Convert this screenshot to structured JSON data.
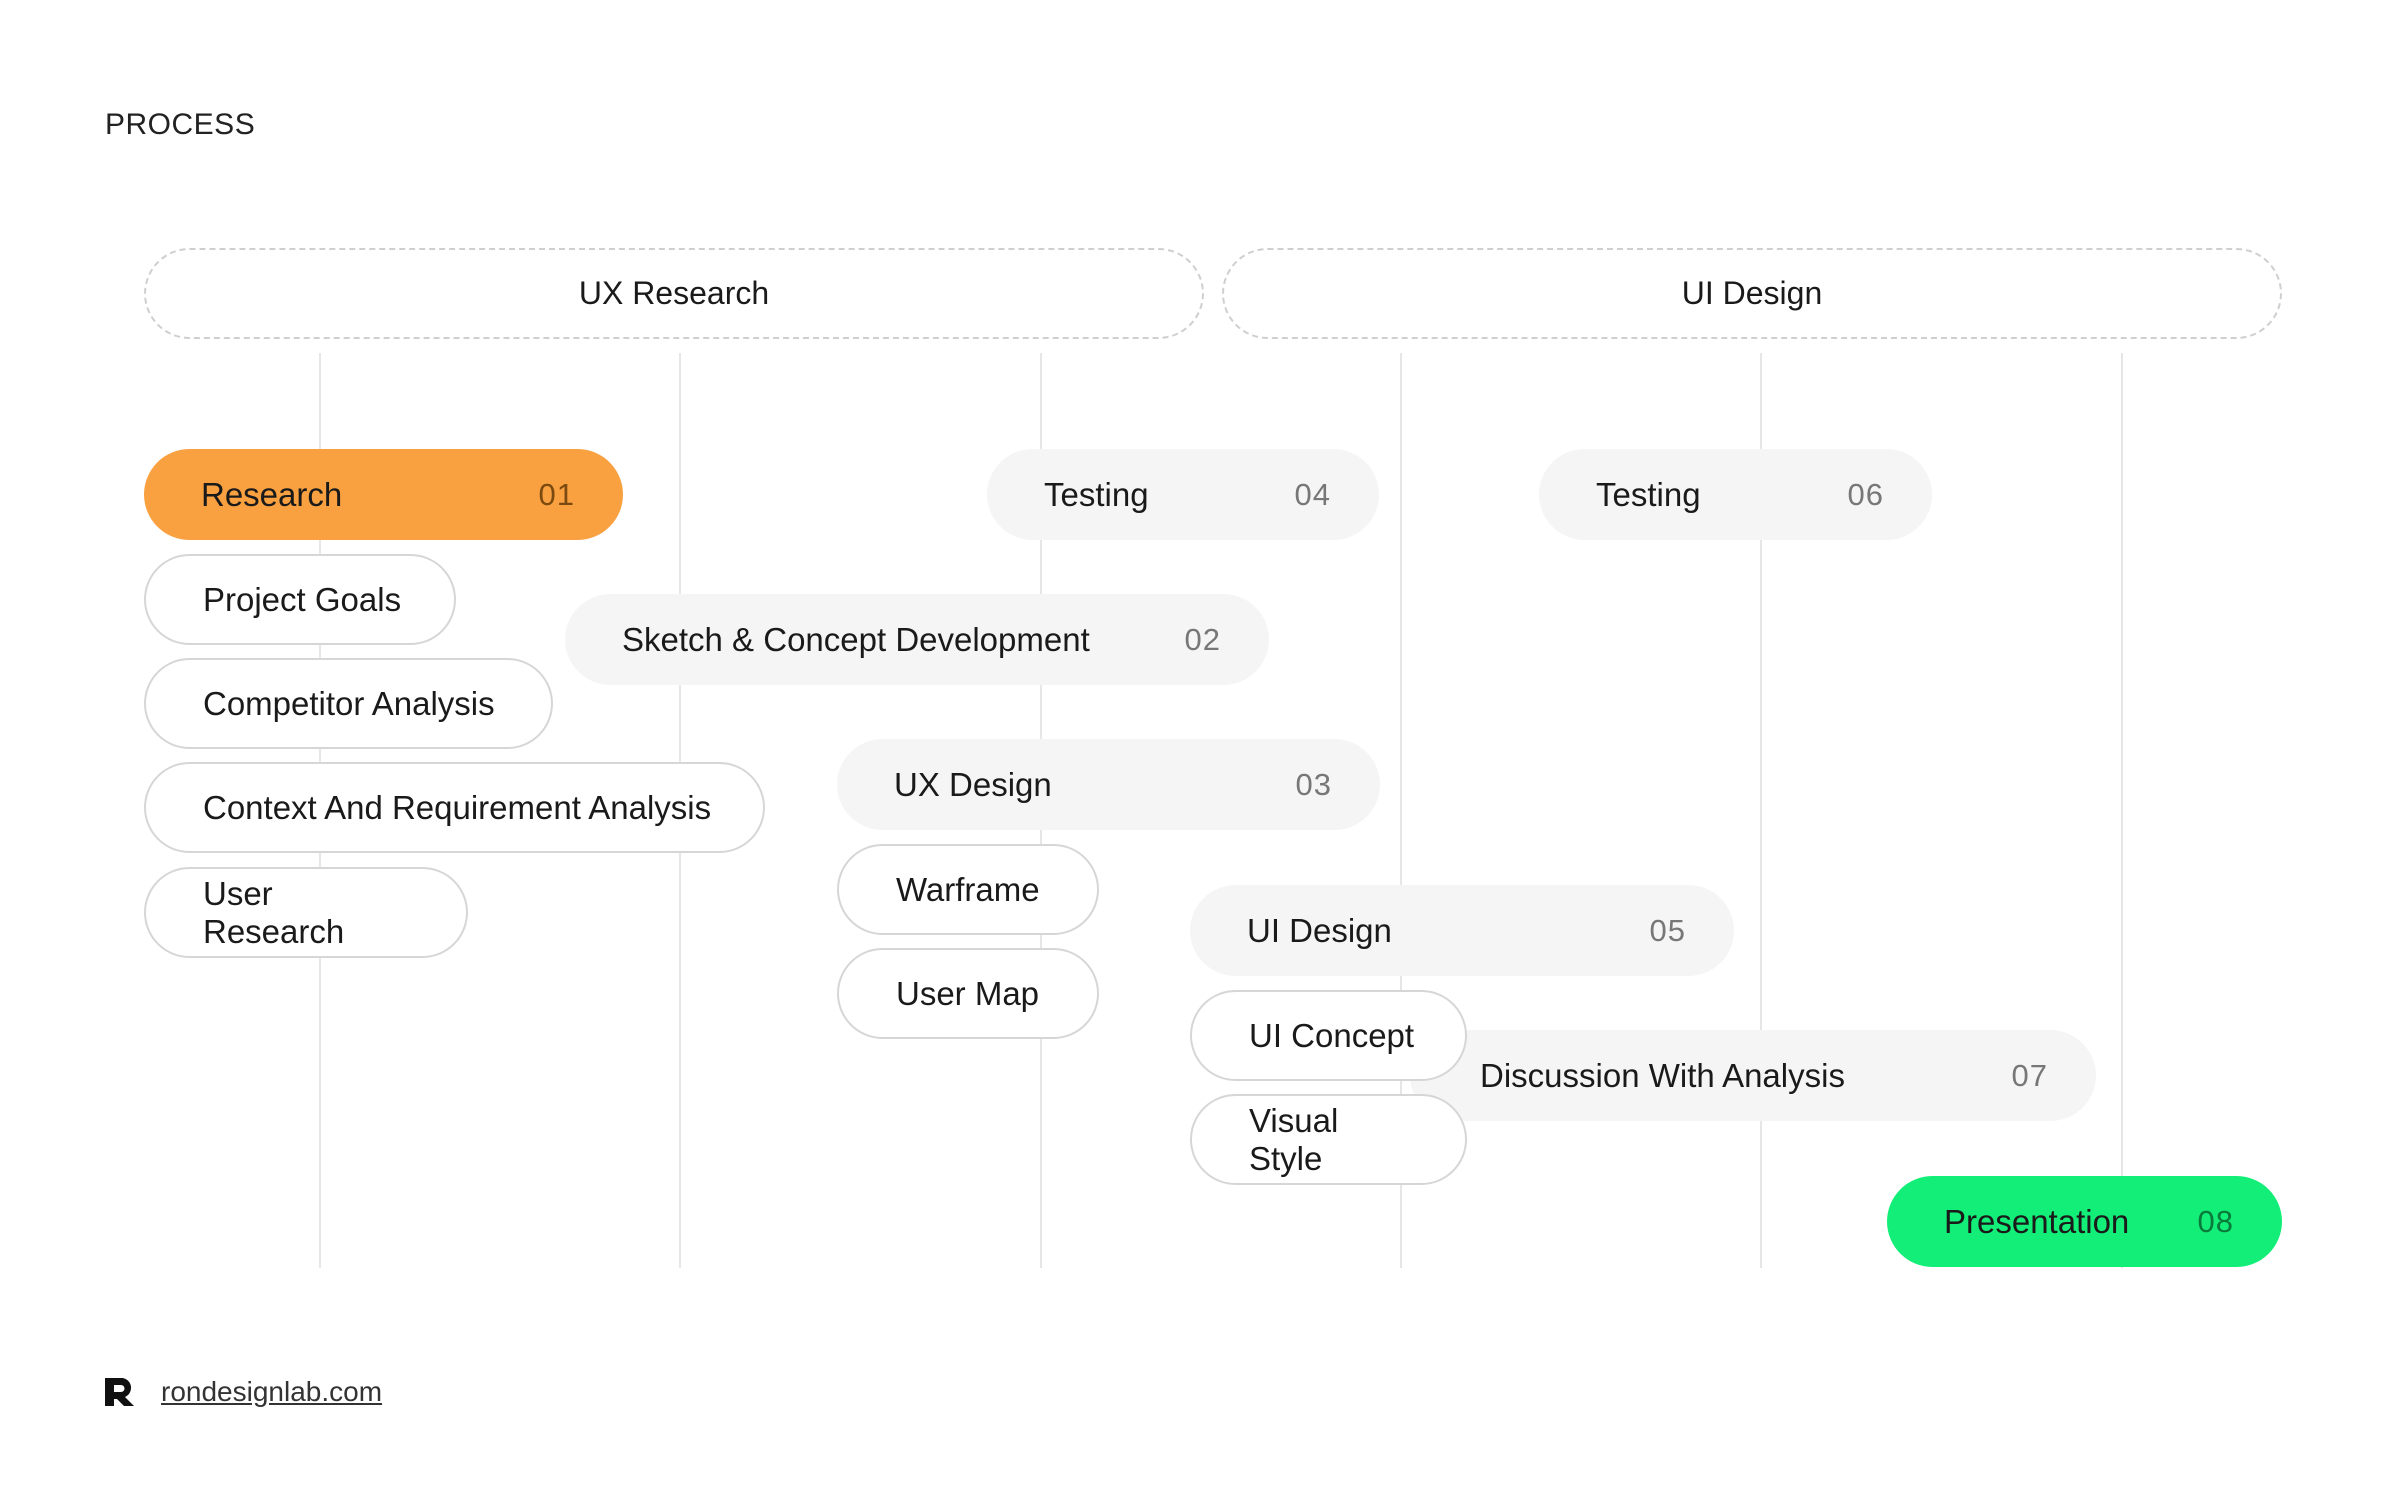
{
  "page": {
    "title": "PROCESS"
  },
  "groups": [
    {
      "label": "UX Research"
    },
    {
      "label": "UI Design"
    }
  ],
  "phases": [
    {
      "label": "Research",
      "number": "01",
      "tasks": [
        "Project Goals",
        "Competitor Analysis",
        "Context And Requirement Analysis",
        "User Research"
      ]
    },
    {
      "label": "Sketch & Concept Development",
      "number": "02"
    },
    {
      "label": "UX Design",
      "number": "03",
      "tasks": [
        "Warframe",
        "User Map"
      ]
    },
    {
      "label": "Testing",
      "number": "04"
    },
    {
      "label": "UI Design",
      "number": "05",
      "tasks": [
        "UI Concept",
        "Visual Style"
      ]
    },
    {
      "label": "Testing",
      "number": "06"
    },
    {
      "label": "Discussion With Analysis",
      "number": "07"
    },
    {
      "label": "Presentation",
      "number": "08"
    }
  ],
  "colors": {
    "accent_start": "#f9a040",
    "accent_end": "#12ee77",
    "phase_bg": "#f5f5f5"
  },
  "footer": {
    "logo": "R-logo-icon",
    "link": "rondesignlab.com"
  }
}
